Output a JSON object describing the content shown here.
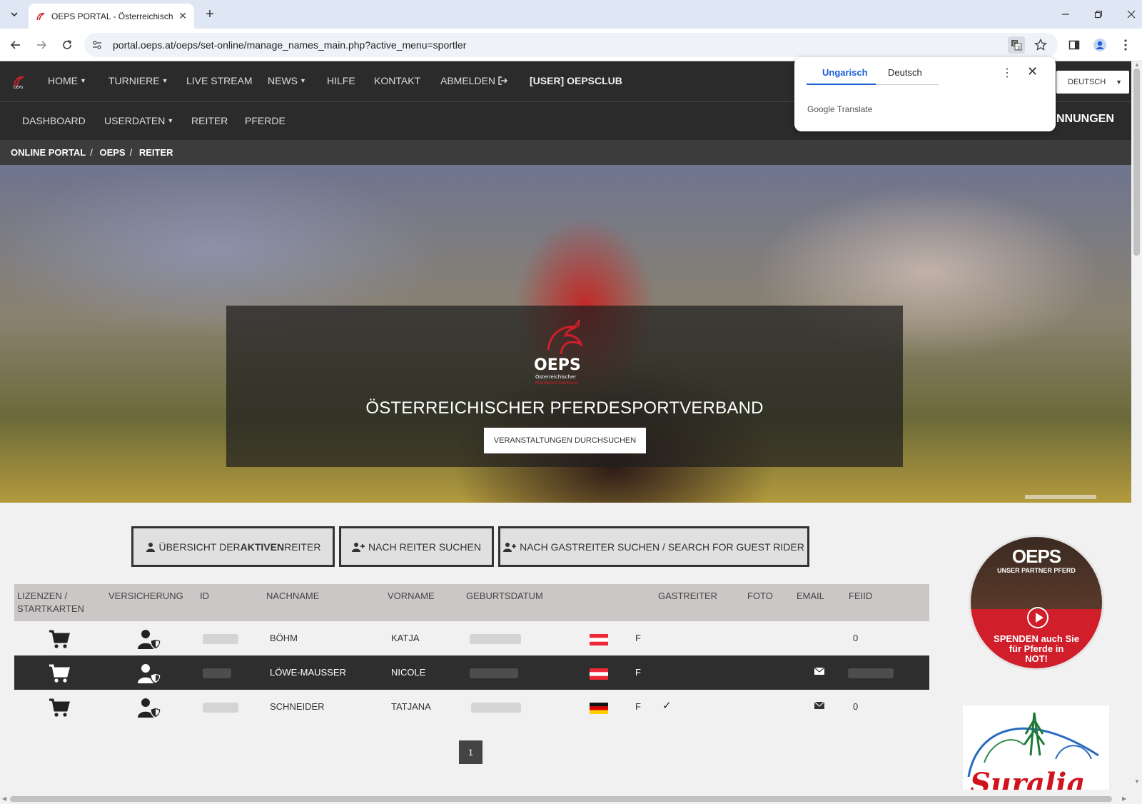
{
  "browser": {
    "tab_title": "OEPS PORTAL - Österreichischer",
    "url": "portal.oeps.at/oeps/set-online/manage_names_main.php?active_menu=sportler"
  },
  "translate_popup": {
    "tab_source": "Ungarisch",
    "tab_target": "Deutsch",
    "brand": "Google Translate"
  },
  "mainnav": {
    "items": [
      {
        "label": "HOME",
        "caret": true
      },
      {
        "label": "TURNIERE",
        "caret": true
      },
      {
        "label": "LIVE STREAM"
      },
      {
        "label": "NEWS",
        "caret": true
      },
      {
        "label": "HILFE"
      },
      {
        "label": "KONTAKT"
      },
      {
        "label": "ABMELDEN"
      },
      {
        "label": "[USER] OEPSCLUB"
      }
    ],
    "language": "DEUTSCH"
  },
  "subnav": {
    "items": [
      "DASHBOARD",
      "USERDATEN",
      "REITER",
      "PFERDE"
    ],
    "right_text": "NNUNGEN"
  },
  "breadcrumb": [
    "ONLINE PORTAL",
    "OEPS",
    "REITER"
  ],
  "hero": {
    "logo_text": "OEPS",
    "logo_sub1": "Österreichischer",
    "logo_sub2": "Pferdesportverband",
    "title": "ÖSTERREICHISCHER PFERDESPORTVERBAND",
    "button": "VERANSTALTUNGEN DURCHSUCHEN"
  },
  "actions": {
    "overview_prefix": "ÜBERSICHT DER ",
    "overview_bold": "AKTIVEN",
    "overview_suffix": " REITER",
    "search_rider": "NACH REITER SUCHEN",
    "search_guest": "NACH GASTREITER SUCHEN / SEARCH FOR GUEST RIDER"
  },
  "table": {
    "headers": {
      "lizenzen_1": "LIZENZEN /",
      "lizenzen_2": "STARTKARTEN",
      "versicherung": "VERSICHERUNG",
      "id": "ID",
      "nachname": "NACHNAME",
      "vorname": "VORNAME",
      "geburtsdatum": "GEBURTSDATUM",
      "gastreiter": "GASTREITER",
      "foto": "FOTO",
      "email": "EMAIL",
      "feiid": "FEIID"
    },
    "rows": [
      {
        "nachname": "BÖHM",
        "vorname": "KATJA",
        "nation": "AUT",
        "geschlecht": "F",
        "gastreiter": "",
        "email": false,
        "feiid": "0"
      },
      {
        "nachname": "LÖWE-MAUSSER",
        "vorname": "NICOLE",
        "nation": "AUT",
        "geschlecht": "F",
        "gastreiter": "",
        "email": true,
        "feiid": ""
      },
      {
        "nachname": "SCHNEIDER",
        "vorname": "TATJANA",
        "nation": "GER",
        "geschlecht": "F",
        "gastreiter": "✓",
        "email": true,
        "feiid": "0"
      }
    ]
  },
  "pagination": {
    "current": "1"
  },
  "sidebar": {
    "ad1_logo": "OEPS",
    "ad1_sub": "UNSER PARTNER PFERD",
    "ad1_line1": "SPENDEN auch Sie",
    "ad1_line2": "für Pferde in",
    "ad1_line3": "NOT!",
    "ad2_text": "Suralia"
  },
  "colors": {
    "nav_bg": "#2b2b2b",
    "brand_red": "#d01f2a",
    "translate_blue": "#1a5fd6"
  }
}
